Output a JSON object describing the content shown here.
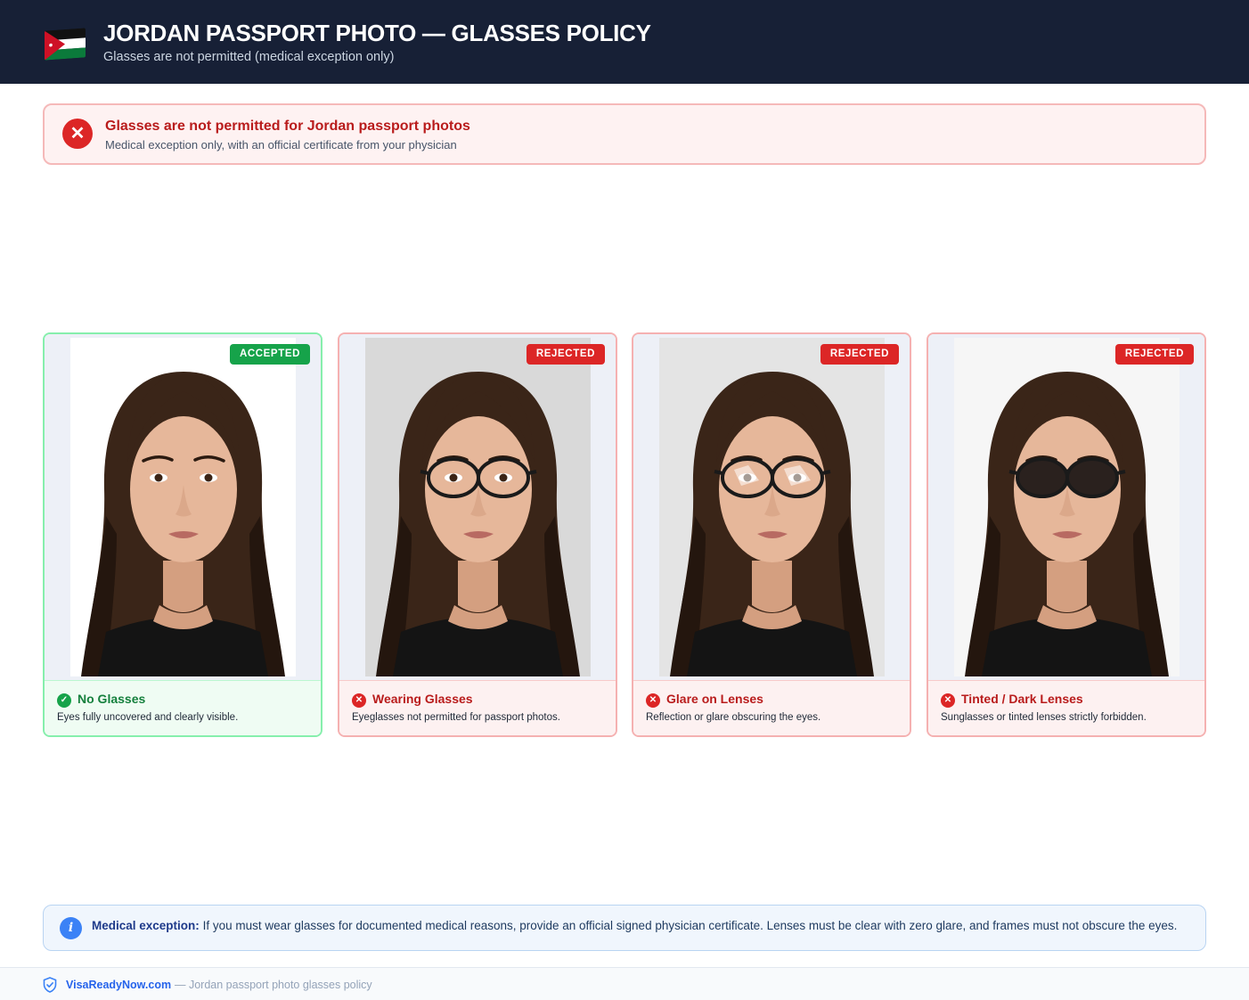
{
  "header": {
    "title": "JORDAN PASSPORT PHOTO — GLASSES POLICY",
    "subtitle": "Glasses are not permitted (medical exception only)",
    "flag_icon": "jordan-flag-icon"
  },
  "alert": {
    "icon": "x-circle-icon",
    "title": "Glasses are not permitted for Jordan passport photos",
    "subtitle": "Medical exception only, with an official certificate from your physician",
    "color": "#dc2626"
  },
  "cards": [
    {
      "badge": "ACCEPTED",
      "status": "accepted",
      "icon": "check-circle-icon",
      "title": "No Glasses",
      "description": "Eyes fully uncovered and clearly visible.",
      "photo_background": "#ffffff"
    },
    {
      "badge": "REJECTED",
      "status": "rejected",
      "icon": "x-circle-icon",
      "title": "Wearing Glasses",
      "description": "Eyeglasses not permitted for passport photos.",
      "photo_background": "#d9d9d9"
    },
    {
      "badge": "REJECTED",
      "status": "rejected",
      "icon": "x-circle-icon",
      "title": "Glare on Lenses",
      "description": "Reflection or glare obscuring the eyes.",
      "photo_background": "#e4e4e4"
    },
    {
      "badge": "REJECTED",
      "status": "rejected",
      "icon": "x-circle-icon",
      "title": "Tinted / Dark Lenses",
      "description": "Sunglasses or tinted lenses strictly forbidden.",
      "photo_background": "#f6f6f6"
    }
  ],
  "info": {
    "icon": "info-icon",
    "label": "Medical exception:",
    "text": "If you must wear glasses for documented medical reasons, provide an official signed physician certificate. Lenses must be clear with zero glare, and frames must not obscure the eyes."
  },
  "footer": {
    "icon": "shield-icon",
    "brand": "VisaReadyNow.com",
    "text": "— Jordan passport photo glasses policy"
  },
  "colors": {
    "accepted": "#16a34a",
    "rejected": "#dc2626",
    "header_bg": "#172036",
    "info_accent": "#3b82f6"
  }
}
